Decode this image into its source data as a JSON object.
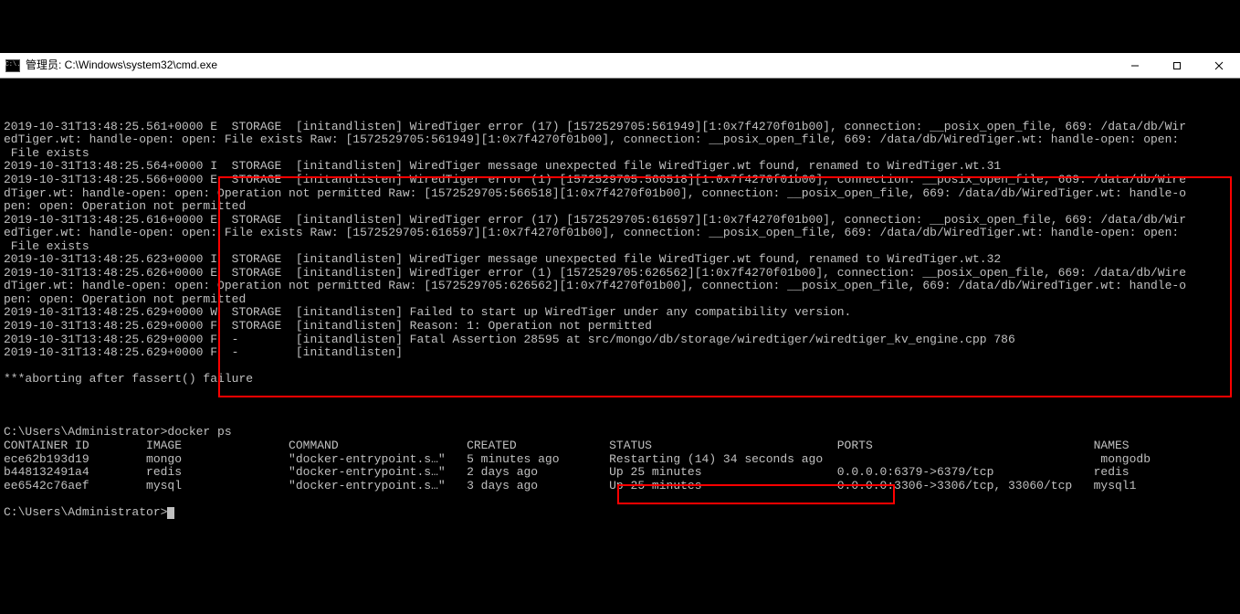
{
  "window": {
    "icon_label": "C:\\.",
    "title": "管理员: C:\\Windows\\system32\\cmd.exe"
  },
  "log": {
    "l1": "2019-10-31T13:48:25.561+0000 E  STORAGE  [initandlisten] WiredTiger error (17) [1572529705:561949][1:0x7f4270f01b00], connection: __posix_open_file, 669: /data/db/Wir",
    "l2": "edTiger.wt: handle-open: open: File exists Raw: [1572529705:561949][1:0x7f4270f01b00], connection: __posix_open_file, 669: /data/db/WiredTiger.wt: handle-open: open:",
    "l3": " File exists",
    "l4": "2019-10-31T13:48:25.564+0000 I  STORAGE  [initandlisten] WiredTiger message unexpected file WiredTiger.wt found, renamed to WiredTiger.wt.31",
    "l5": "2019-10-31T13:48:25.566+0000 E  STORAGE  [initandlisten] WiredTiger error (1) [1572529705:566518][1:0x7f4270f01b00], connection: __posix_open_file, 669: /data/db/Wire",
    "l6": "dTiger.wt: handle-open: open: Operation not permitted Raw: [1572529705:566518][1:0x7f4270f01b00], connection: __posix_open_file, 669: /data/db/WiredTiger.wt: handle-o",
    "l7": "pen: open: Operation not permitted",
    "l8": "2019-10-31T13:48:25.616+0000 E  STORAGE  [initandlisten] WiredTiger error (17) [1572529705:616597][1:0x7f4270f01b00], connection: __posix_open_file, 669: /data/db/Wir",
    "l9": "edTiger.wt: handle-open: open: File exists Raw: [1572529705:616597][1:0x7f4270f01b00], connection: __posix_open_file, 669: /data/db/WiredTiger.wt: handle-open: open:",
    "l10": " File exists",
    "l11": "2019-10-31T13:48:25.623+0000 I  STORAGE  [initandlisten] WiredTiger message unexpected file WiredTiger.wt found, renamed to WiredTiger.wt.32",
    "l12": "2019-10-31T13:48:25.626+0000 E  STORAGE  [initandlisten] WiredTiger error (1) [1572529705:626562][1:0x7f4270f01b00], connection: __posix_open_file, 669: /data/db/Wire",
    "l13": "dTiger.wt: handle-open: open: Operation not permitted Raw: [1572529705:626562][1:0x7f4270f01b00], connection: __posix_open_file, 669: /data/db/WiredTiger.wt: handle-o",
    "l14": "pen: open: Operation not permitted",
    "l15": "2019-10-31T13:48:25.629+0000 W  STORAGE  [initandlisten] Failed to start up WiredTiger under any compatibility version.",
    "l16": "2019-10-31T13:48:25.629+0000 F  STORAGE  [initandlisten] Reason: 1: Operation not permitted",
    "l17": "2019-10-31T13:48:25.629+0000 F  -        [initandlisten] Fatal Assertion 28595 at src/mongo/db/storage/wiredtiger/wiredtiger_kv_engine.cpp 786",
    "l18": "2019-10-31T13:48:25.629+0000 F  -        [initandlisten]",
    "l19": "",
    "l20": "***aborting after fassert() failure",
    "l21": "",
    "l22": "",
    "l23": "",
    "l24": "C:\\Users\\Administrator>docker ps",
    "l25": "CONTAINER ID        IMAGE               COMMAND                  CREATED             STATUS                          PORTS                               NAMES",
    "l26": "ece62b193d19        mongo               \"docker-entrypoint.s…\"   5 minutes ago       Restarting (14) 34 seconds ago                                       mongodb",
    "l27": "b448132491a4        redis               \"docker-entrypoint.s…\"   2 days ago          Up 25 minutes                   0.0.0.0:6379->6379/tcp              redis",
    "l28": "ee6542c76aef        mysql               \"docker-entrypoint.s…\"   3 days ago          Up 25 minutes                   0.0.0.0:3306->3306/tcp, 33060/tcp   mysql1",
    "l29": "",
    "l30": "C:\\Users\\Administrator>"
  }
}
